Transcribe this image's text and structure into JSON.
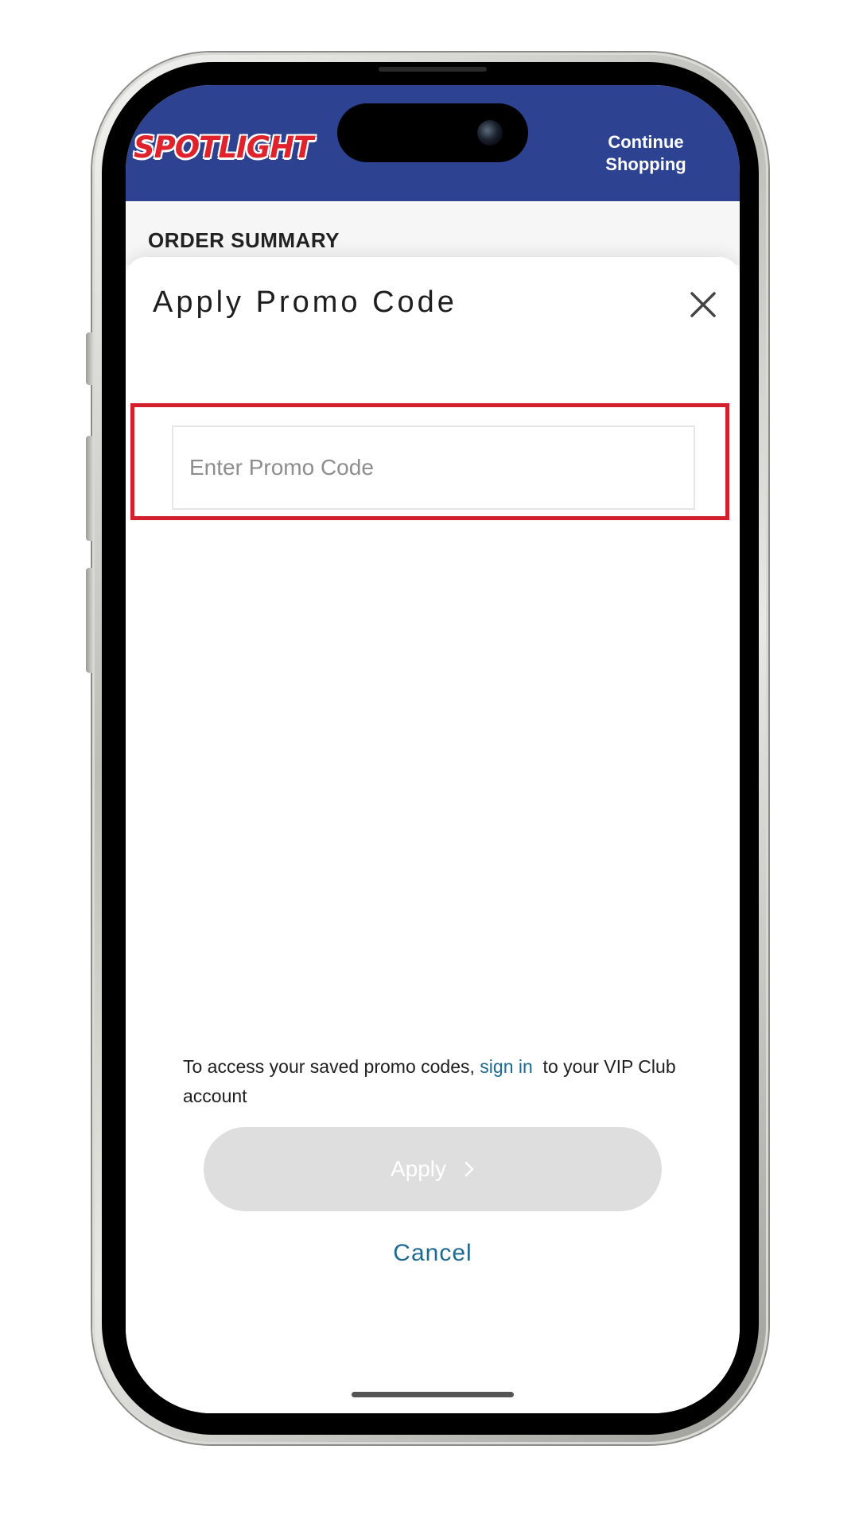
{
  "header": {
    "logo_text": "SPOTLIGHT",
    "continue_shopping_label": "Continue Shopping"
  },
  "background_page": {
    "section_title": "ORDER SUMMARY"
  },
  "modal": {
    "title": "Apply Promo Code",
    "promo_input": {
      "value": "",
      "placeholder": "Enter Promo Code"
    },
    "vip_note": {
      "before_link": "To access your saved promo codes, ",
      "link_text": "sign in",
      "after_link": "  to your VIP Club account"
    },
    "apply_label": "Apply",
    "cancel_label": "Cancel"
  },
  "icons": {
    "close": "close-icon",
    "apply_chevron": "chevron-right-icon"
  },
  "colors": {
    "header_bg": "#2d4391",
    "logo_red": "#e0222d",
    "highlight_red": "#d4202c",
    "link_blue": "#1d6a93",
    "button_disabled_bg": "#dedede"
  }
}
